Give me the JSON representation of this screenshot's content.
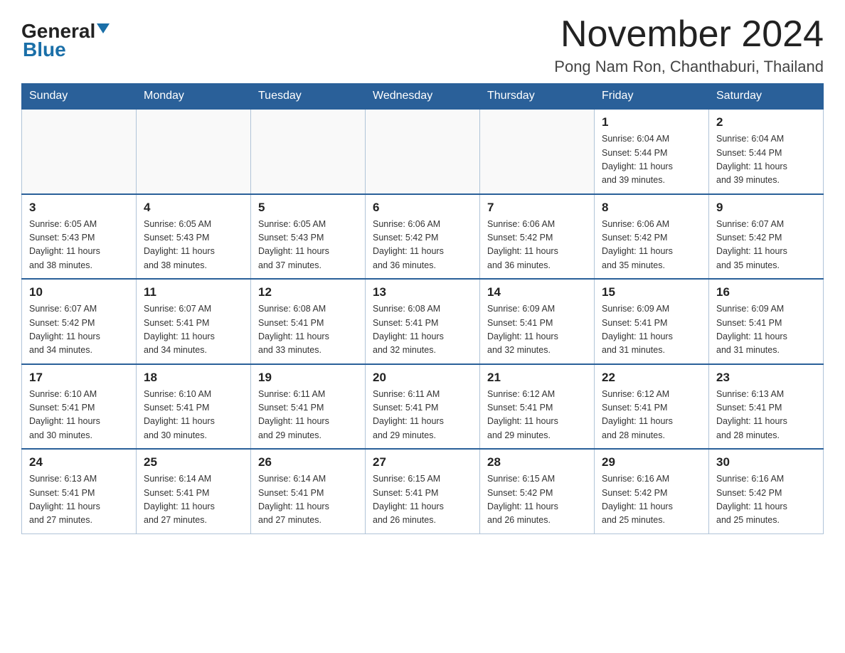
{
  "header": {
    "logo_general": "General",
    "logo_blue": "Blue",
    "month_title": "November 2024",
    "location": "Pong Nam Ron, Chanthaburi, Thailand"
  },
  "weekdays": [
    "Sunday",
    "Monday",
    "Tuesday",
    "Wednesday",
    "Thursday",
    "Friday",
    "Saturday"
  ],
  "weeks": [
    [
      {
        "day": "",
        "info": ""
      },
      {
        "day": "",
        "info": ""
      },
      {
        "day": "",
        "info": ""
      },
      {
        "day": "",
        "info": ""
      },
      {
        "day": "",
        "info": ""
      },
      {
        "day": "1",
        "info": "Sunrise: 6:04 AM\nSunset: 5:44 PM\nDaylight: 11 hours\nand 39 minutes."
      },
      {
        "day": "2",
        "info": "Sunrise: 6:04 AM\nSunset: 5:44 PM\nDaylight: 11 hours\nand 39 minutes."
      }
    ],
    [
      {
        "day": "3",
        "info": "Sunrise: 6:05 AM\nSunset: 5:43 PM\nDaylight: 11 hours\nand 38 minutes."
      },
      {
        "day": "4",
        "info": "Sunrise: 6:05 AM\nSunset: 5:43 PM\nDaylight: 11 hours\nand 38 minutes."
      },
      {
        "day": "5",
        "info": "Sunrise: 6:05 AM\nSunset: 5:43 PM\nDaylight: 11 hours\nand 37 minutes."
      },
      {
        "day": "6",
        "info": "Sunrise: 6:06 AM\nSunset: 5:42 PM\nDaylight: 11 hours\nand 36 minutes."
      },
      {
        "day": "7",
        "info": "Sunrise: 6:06 AM\nSunset: 5:42 PM\nDaylight: 11 hours\nand 36 minutes."
      },
      {
        "day": "8",
        "info": "Sunrise: 6:06 AM\nSunset: 5:42 PM\nDaylight: 11 hours\nand 35 minutes."
      },
      {
        "day": "9",
        "info": "Sunrise: 6:07 AM\nSunset: 5:42 PM\nDaylight: 11 hours\nand 35 minutes."
      }
    ],
    [
      {
        "day": "10",
        "info": "Sunrise: 6:07 AM\nSunset: 5:42 PM\nDaylight: 11 hours\nand 34 minutes."
      },
      {
        "day": "11",
        "info": "Sunrise: 6:07 AM\nSunset: 5:41 PM\nDaylight: 11 hours\nand 34 minutes."
      },
      {
        "day": "12",
        "info": "Sunrise: 6:08 AM\nSunset: 5:41 PM\nDaylight: 11 hours\nand 33 minutes."
      },
      {
        "day": "13",
        "info": "Sunrise: 6:08 AM\nSunset: 5:41 PM\nDaylight: 11 hours\nand 32 minutes."
      },
      {
        "day": "14",
        "info": "Sunrise: 6:09 AM\nSunset: 5:41 PM\nDaylight: 11 hours\nand 32 minutes."
      },
      {
        "day": "15",
        "info": "Sunrise: 6:09 AM\nSunset: 5:41 PM\nDaylight: 11 hours\nand 31 minutes."
      },
      {
        "day": "16",
        "info": "Sunrise: 6:09 AM\nSunset: 5:41 PM\nDaylight: 11 hours\nand 31 minutes."
      }
    ],
    [
      {
        "day": "17",
        "info": "Sunrise: 6:10 AM\nSunset: 5:41 PM\nDaylight: 11 hours\nand 30 minutes."
      },
      {
        "day": "18",
        "info": "Sunrise: 6:10 AM\nSunset: 5:41 PM\nDaylight: 11 hours\nand 30 minutes."
      },
      {
        "day": "19",
        "info": "Sunrise: 6:11 AM\nSunset: 5:41 PM\nDaylight: 11 hours\nand 29 minutes."
      },
      {
        "day": "20",
        "info": "Sunrise: 6:11 AM\nSunset: 5:41 PM\nDaylight: 11 hours\nand 29 minutes."
      },
      {
        "day": "21",
        "info": "Sunrise: 6:12 AM\nSunset: 5:41 PM\nDaylight: 11 hours\nand 29 minutes."
      },
      {
        "day": "22",
        "info": "Sunrise: 6:12 AM\nSunset: 5:41 PM\nDaylight: 11 hours\nand 28 minutes."
      },
      {
        "day": "23",
        "info": "Sunrise: 6:13 AM\nSunset: 5:41 PM\nDaylight: 11 hours\nand 28 minutes."
      }
    ],
    [
      {
        "day": "24",
        "info": "Sunrise: 6:13 AM\nSunset: 5:41 PM\nDaylight: 11 hours\nand 27 minutes."
      },
      {
        "day": "25",
        "info": "Sunrise: 6:14 AM\nSunset: 5:41 PM\nDaylight: 11 hours\nand 27 minutes."
      },
      {
        "day": "26",
        "info": "Sunrise: 6:14 AM\nSunset: 5:41 PM\nDaylight: 11 hours\nand 27 minutes."
      },
      {
        "day": "27",
        "info": "Sunrise: 6:15 AM\nSunset: 5:41 PM\nDaylight: 11 hours\nand 26 minutes."
      },
      {
        "day": "28",
        "info": "Sunrise: 6:15 AM\nSunset: 5:42 PM\nDaylight: 11 hours\nand 26 minutes."
      },
      {
        "day": "29",
        "info": "Sunrise: 6:16 AM\nSunset: 5:42 PM\nDaylight: 11 hours\nand 25 minutes."
      },
      {
        "day": "30",
        "info": "Sunrise: 6:16 AM\nSunset: 5:42 PM\nDaylight: 11 hours\nand 25 minutes."
      }
    ]
  ]
}
